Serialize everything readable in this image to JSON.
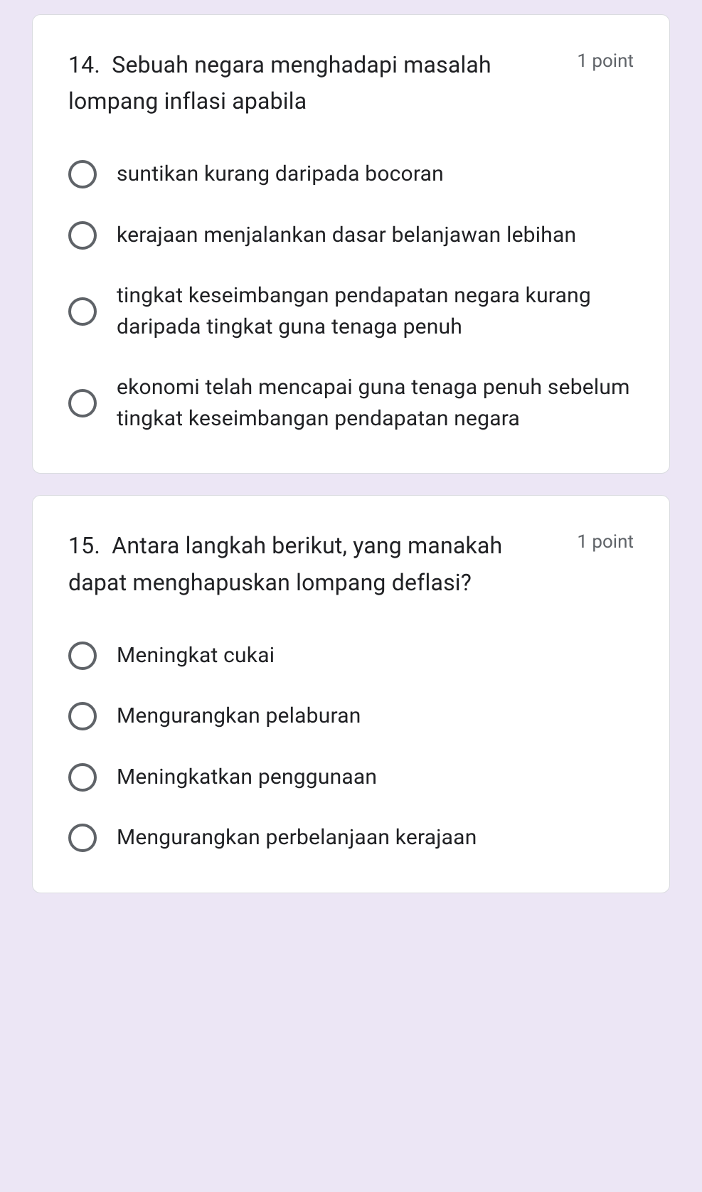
{
  "questions": [
    {
      "number": "14.",
      "text": "Sebuah negara menghadapi masalah lompang inflasi apabila",
      "points": "1 point",
      "options": [
        "suntikan kurang daripada bocoran",
        "kerajaan menjalankan dasar belanjawan lebihan",
        "tingkat keseimbangan pendapatan negara kurang daripada tingkat guna tenaga penuh",
        "ekonomi telah mencapai guna tenaga penuh sebelum tingkat keseimbangan pendapatan negara"
      ]
    },
    {
      "number": "15.",
      "text": "Antara langkah berikut, yang manakah dapat menghapuskan lompang deflasi?",
      "points": "1 point",
      "options": [
        "Meningkat cukai",
        "Mengurangkan pelaburan",
        "Meningkatkan penggunaan",
        "Mengurangkan perbelanjaan kerajaan"
      ]
    }
  ]
}
